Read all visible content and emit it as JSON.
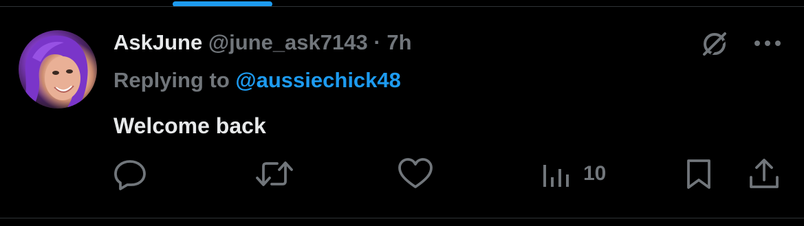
{
  "tweet": {
    "author_name": "AskJune",
    "handle": "@june_ask7143",
    "separator": "·",
    "time": "7h",
    "reply_prefix": "Replying to",
    "reply_handle": "@aussiechick48",
    "text": "Welcome back"
  },
  "actions": {
    "views_count": "10"
  },
  "icons": {
    "grok": "grok-icon",
    "more": "more-options-icon",
    "reply": "reply-icon",
    "retweet": "retweet-icon",
    "like": "heart-icon",
    "views": "views-bar-chart-icon",
    "bookmark": "bookmark-icon",
    "share": "share-icon"
  },
  "colors": {
    "background": "#000000",
    "primary_text": "#e7e9ea",
    "secondary_text": "#71767b",
    "accent": "#1d9bf0",
    "divider": "#2f3336"
  }
}
